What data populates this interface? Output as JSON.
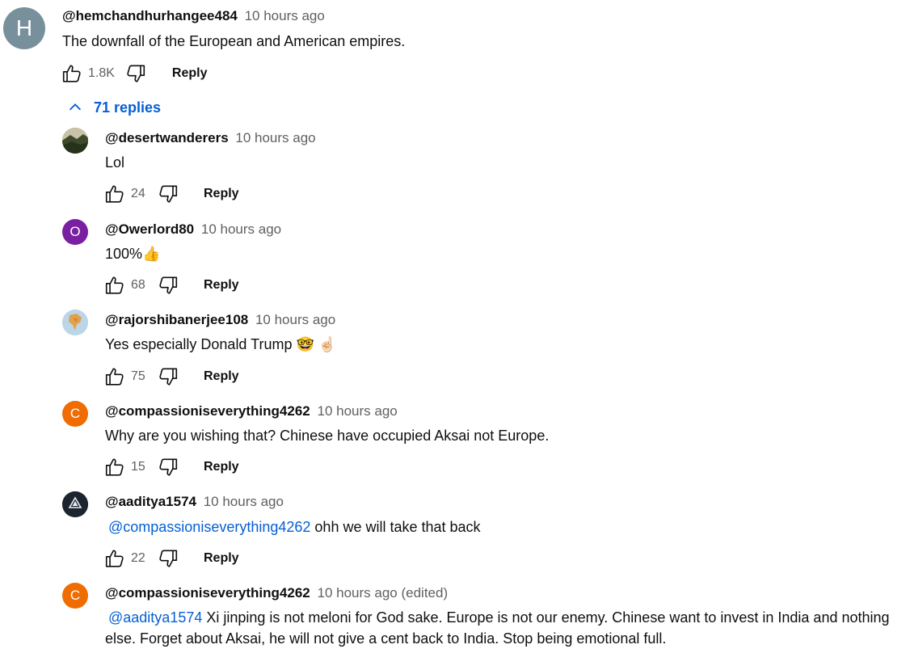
{
  "top_comment": {
    "avatar_letter": "H",
    "author": "@hemchandhurhangee484",
    "time": "10 hours ago",
    "text": "The downfall of the European and American empires.",
    "likes": "1.8K",
    "reply_label": "Reply",
    "replies_toggle": "71 replies"
  },
  "replies": [
    {
      "author": "@desertwanderers",
      "time": "10 hours ago",
      "text": "Lol",
      "likes": "24",
      "reply_label": "Reply",
      "avatar": "landscape-photo-icon"
    },
    {
      "author": "@Owerlord80",
      "time": "10 hours ago",
      "text": "100%👍",
      "likes": "68",
      "reply_label": "Reply",
      "avatar_letter": "O",
      "avatar_color": "#7b1fa2"
    },
    {
      "author": "@rajorshibanerjee108",
      "time": "10 hours ago",
      "text": "Yes especially Donald Trump 🤓 ☝🏻",
      "likes": "75",
      "reply_label": "Reply",
      "avatar": "map-photo-icon"
    },
    {
      "author": "@compassioniseverything4262",
      "time": "10 hours ago",
      "text": "Why are you wishing that? Chinese have occupied Aksai not Europe.",
      "likes": "15",
      "reply_label": "Reply",
      "avatar_letter": "C",
      "avatar_color": "#ef6c00"
    },
    {
      "author": "@aaditya1574",
      "time": "10 hours ago",
      "mention": "@compassioniseverything4262",
      "text": " ohh we will take that back",
      "likes": "22",
      "reply_label": "Reply",
      "avatar": "logo-icon"
    },
    {
      "author": "@compassioniseverything4262",
      "time": "10 hours ago",
      "edited": "(edited)",
      "mention": "@aaditya1574",
      "text": "  Xi jinping is not meloni for God sake. Europe is not our enemy. Chinese want to invest in India and nothing else. Forget about Aksai, he will not give a cent back to India. Stop being emotional full.",
      "avatar_letter": "C",
      "avatar_color": "#ef6c00"
    }
  ],
  "colors": {
    "link": "#065fd4",
    "muted": "#606060",
    "text": "#0f0f0f"
  }
}
